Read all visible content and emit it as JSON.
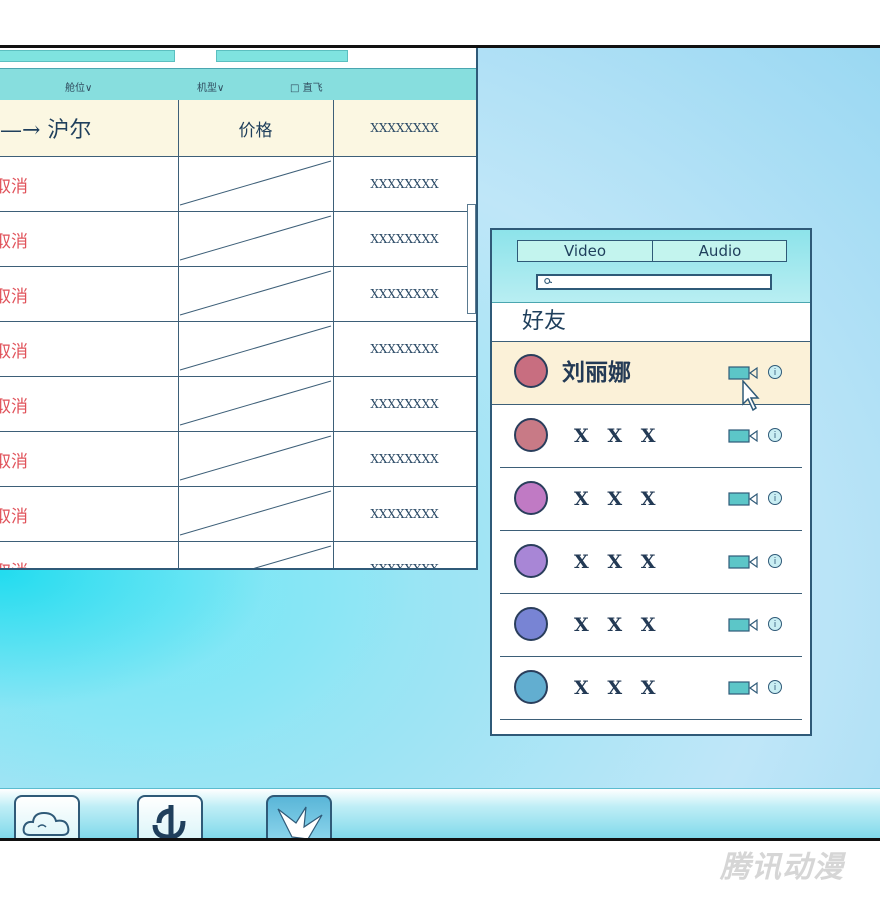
{
  "flight_window": {
    "filters": {
      "cabin": "舱位∨",
      "aircraft": "机型∨",
      "direct": "□ 直飞"
    },
    "header": {
      "route": "—→ 沪尔",
      "price": "价格",
      "value": "XXXXXXXX"
    },
    "rows": [
      {
        "status": "取消",
        "value": "XXXXXXXX"
      },
      {
        "status": "取消",
        "value": "XXXXXXXX"
      },
      {
        "status": "取消",
        "value": "XXXXXXXX"
      },
      {
        "status": "取消",
        "value": "XXXXXXXX"
      },
      {
        "status": "取消",
        "value": "XXXXXXXX"
      },
      {
        "status": "取消",
        "value": "XXXXXXXX"
      },
      {
        "status": "取消",
        "value": "XXXXXXXX"
      },
      {
        "status": "取消",
        "value": "XXXXXXXX"
      }
    ],
    "colors": {
      "cancel": "#e0525a",
      "header_bg": "#fbf7e2",
      "filter_bar": "#87dede"
    }
  },
  "friends_window": {
    "tabs": [
      {
        "label": "Video"
      },
      {
        "label": "Audio"
      }
    ],
    "search_icon": "search-icon",
    "section_title": "好友",
    "friends": [
      {
        "name": "刘丽娜",
        "avatar_color": "#c86e80"
      },
      {
        "name": "X X X",
        "avatar_color": "#c87a86"
      },
      {
        "name": "X X X",
        "avatar_color": "#c07ac4"
      },
      {
        "name": "X X X",
        "avatar_color": "#a886d6"
      },
      {
        "name": "X X X",
        "avatar_color": "#7884d4"
      },
      {
        "name": "X X X",
        "avatar_color": "#62aed0"
      }
    ],
    "info_glyph": "i",
    "icons": {
      "call": "video-camera-icon",
      "info": "info-icon"
    }
  },
  "taskbar": {
    "icons": [
      "cloud-icon",
      "chat-app-icon",
      "bird-app-icon"
    ]
  },
  "watermark": "腾讯动漫"
}
